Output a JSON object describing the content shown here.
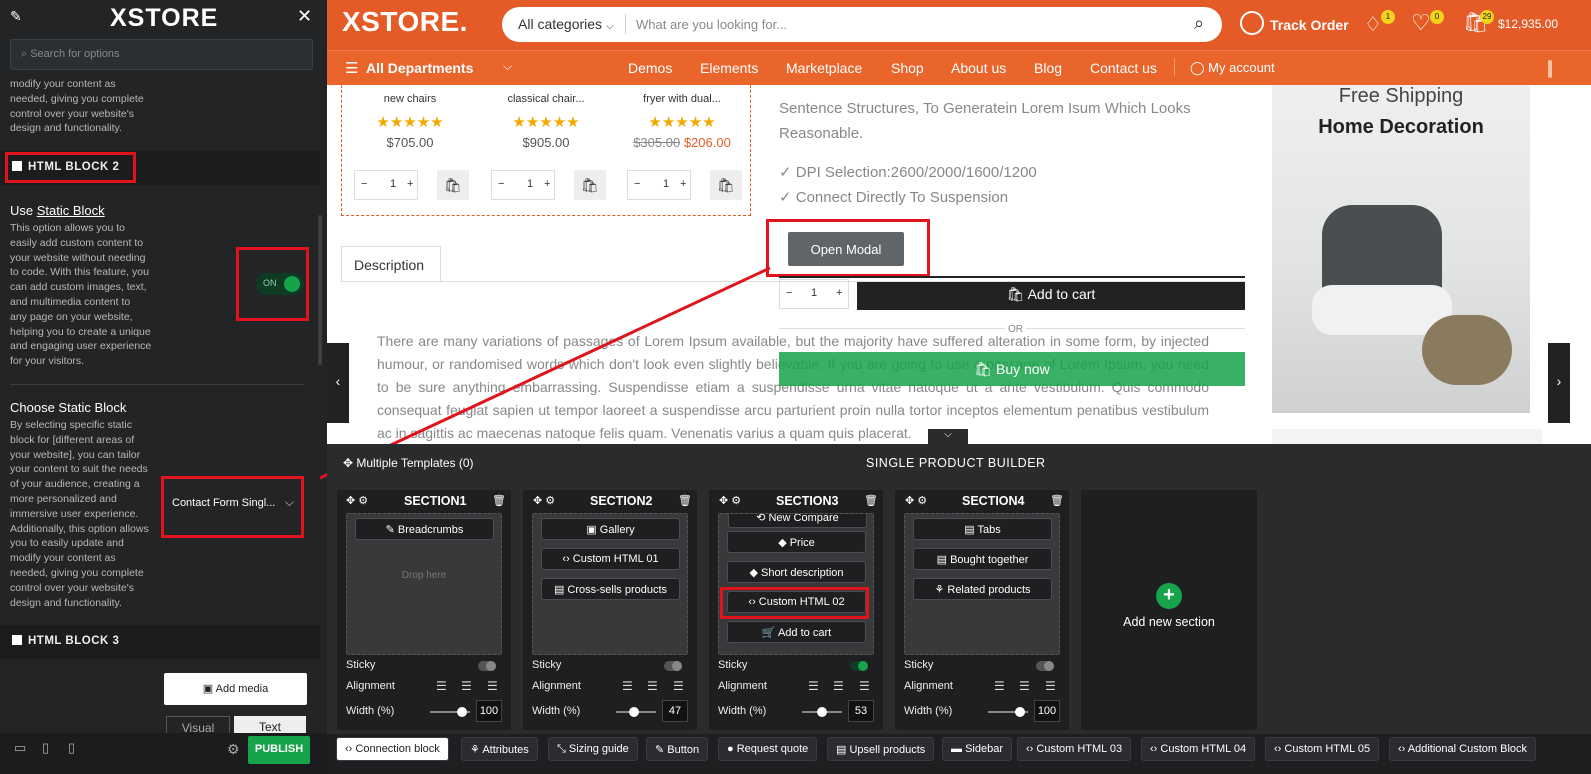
{
  "left_panel": {
    "logo": "XSTORE",
    "search_placeholder": "Search for options",
    "intro_text": [
      "modify your content as",
      "needed, giving you complete",
      "control over your website's",
      "design and functionality."
    ],
    "block2_title": "HTML BLOCK 2",
    "use_static_label": "Use ",
    "use_static_link": "Static Block",
    "use_static_desc": [
      "This option allows you to",
      "easily add custom content to",
      "your website without needing",
      "to code. With this feature, you",
      "can add custom images, text,",
      "and multimedia content to",
      "any page on your website,",
      "helping you to create a unique",
      "and engaging user experience",
      "for your visitors."
    ],
    "toggle_label": "ON",
    "choose_title": "Choose Static Block",
    "choose_desc": [
      "By selecting specific static",
      "block for [different areas of",
      "your website], you can tailor",
      "your content to suit the needs",
      "of your audience, creating a",
      "more personalized and",
      "immersive user experience.",
      "Additionally, this option allows",
      "you to easily update and",
      "modify your content as",
      "needed, giving you complete",
      "control over your website's",
      "design and functionality."
    ],
    "select_value": "Contact Form Singl...",
    "block3_title": "HTML BLOCK 3",
    "add_media": "Add media",
    "tab_visual": "Visual",
    "tab_text": "Text",
    "publish": "PUBLISH"
  },
  "header": {
    "logo": "XSTORE.",
    "category": "All categories",
    "search_placeholder": "What are you looking for...",
    "track_order": "Track Order",
    "notif_count": "1",
    "wishlist_count": "0",
    "cart_count": "29",
    "cart_total": "$12,935.00"
  },
  "nav": {
    "departments": "All Departments",
    "items": [
      "Demos",
      "Elements",
      "Marketplace",
      "Shop",
      "About us",
      "Blog",
      "Contact us"
    ],
    "account": "My account"
  },
  "products": [
    {
      "name": "new chairs",
      "stars": "★★★★★",
      "price": "$705.00",
      "old": "",
      "qty": "1"
    },
    {
      "name": "classical chair...",
      "stars": "★★★★★",
      "price": "$905.00",
      "old": "",
      "qty": "1"
    },
    {
      "name": "fryer with dual...",
      "stars": "★★★★★",
      "price": "$206.00",
      "old": "$305.00",
      "qty": "1"
    }
  ],
  "detail": {
    "frag1": "Sentence Structures, To Generatein Lorem Isum Which Looks",
    "frag2": "Reasonable.",
    "feature1": "DPI Selection:2600/2000/1600/1200",
    "feature2": "Connect Directly To Suspension",
    "open_modal": "Open Modal",
    "qty": "1",
    "add_to_cart": "Add to cart",
    "or": "OR",
    "buy_now": "Buy now",
    "desc_tab": "Description",
    "desc_text": "There are many variations of passages of Lorem Ipsum available, but the majority have suffered alteration in some form, by injected humour, or randomised words which don't look even slightly believable. If you are going to use a passage of Lorem Ipsum, you need to be sure anything embarrassing. Suspendisse etiam a suspendisse urna vitae natoque ut a ante vestibulum. Quis commodo consequat feugiat sapien ut tempor laoreet a suspendisse arcu parturient proin nulla tortor inceptos elementum penatibus vestibulum ac in sagittis ac maecenas natoque felis quam. Venenatis varius a quam quis placerat."
  },
  "promo": {
    "line1": "Free Shipping",
    "line2": "Home Decoration"
  },
  "builder": {
    "templates": "Multiple Templates (0)",
    "title": "SINGLE PRODUCT BUILDER",
    "sticky": "Sticky",
    "alignment": "Alignment",
    "width": "Width (%)",
    "drop_here": "Drop here",
    "add_section": "Add new section",
    "sections": [
      {
        "title": "SECTION1",
        "items": [
          "Breadcrumbs"
        ],
        "width": "100",
        "sticky": "off"
      },
      {
        "title": "SECTION2",
        "items": [
          "Gallery",
          "Custom HTML 01",
          "Cross-sells products"
        ],
        "width": "47",
        "sticky": "off"
      },
      {
        "title": "SECTION3",
        "items": [
          "New Compare",
          "Price",
          "Short description",
          "Custom HTML 02",
          "Add to cart"
        ],
        "width": "53",
        "sticky": "on"
      },
      {
        "title": "SECTION4",
        "items": [
          "Tabs",
          "Bought together",
          "Related products"
        ],
        "width": "100",
        "sticky": "off"
      }
    ],
    "tags": [
      "Connection block",
      "Attributes",
      "Sizing guide",
      "Button",
      "Request quote",
      "Upsell products",
      "Sidebar",
      "Custom HTML 03",
      "Custom HTML 04",
      "Custom HTML 05",
      "Additional Custom Block"
    ]
  },
  "colors": {
    "header": "#e45b27",
    "accent_green": "#16a34a",
    "highlight_red": "#e0141c",
    "star": "#f2a900"
  }
}
